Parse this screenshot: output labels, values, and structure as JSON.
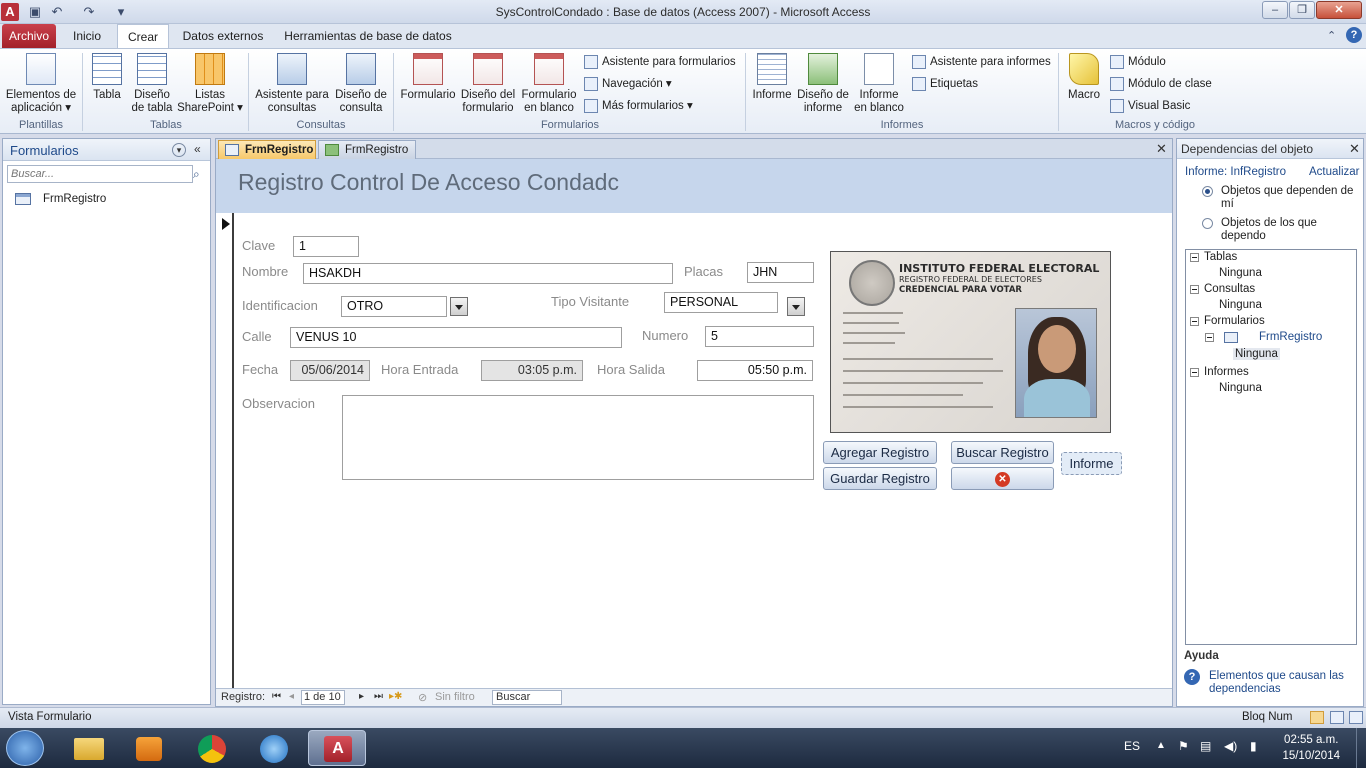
{
  "window": {
    "title": "SysControlCondado : Base de datos (Access 2007)  -  Microsoft Access",
    "min": "–",
    "max": "❐",
    "close": "✕"
  },
  "quick_access": [
    "save-icon",
    "undo-icon",
    "redo-icon",
    "customize-icon"
  ],
  "ribbon_tabs": [
    "Archivo",
    "Inicio",
    "Crear",
    "Datos externos",
    "Herramientas de base de datos"
  ],
  "ribbon": {
    "plantillas": {
      "label": "Plantillas",
      "btn1": "Elementos de",
      "btn2": "aplicación ▾"
    },
    "tablas": {
      "label": "Tablas",
      "tabla": "Tabla",
      "diseno1": "Diseño",
      "diseno2": "de tabla",
      "listas1": "Listas",
      "listas2": "SharePoint ▾"
    },
    "consultas": {
      "label": "Consultas",
      "asis1": "Asistente para",
      "asis2": "consultas",
      "dis1": "Diseño de",
      "dis2": "consulta"
    },
    "formularios": {
      "label": "Formularios",
      "form": "Formulario",
      "dis1": "Diseño del",
      "dis2": "formulario",
      "blank1": "Formulario",
      "blank2": "en blanco",
      "asis": "Asistente para formularios",
      "nav": "Navegación ▾",
      "mas": "Más formularios ▾"
    },
    "informes": {
      "label": "Informes",
      "inf": "Informe",
      "dis1": "Diseño de",
      "dis2": "informe",
      "blank1": "Informe",
      "blank2": "en blanco",
      "asis": "Asistente para informes",
      "etiq": "Etiquetas"
    },
    "macros": {
      "label": "Macros y código",
      "macro": "Macro",
      "modulo": "Módulo",
      "clase": "Módulo de clase",
      "vb": "Visual Basic"
    }
  },
  "nav_pane": {
    "title": "Formularios",
    "search_placeholder": "Buscar...",
    "items": [
      "FrmRegistro"
    ]
  },
  "doc_tabs": [
    "FrmRegistro",
    "FrmRegistro"
  ],
  "form": {
    "title": "Registro Control De Acceso Condadc",
    "fields": {
      "clave_label": "Clave",
      "clave": "1",
      "nombre_label": "Nombre",
      "nombre": "HSAKDH",
      "placas_label": "Placas",
      "placas": "JHN",
      "ident_label": "Identificacion",
      "ident": "OTRO",
      "tipo_label": "Tipo Visitante",
      "tipo": "PERSONAL",
      "calle_label": "Calle",
      "calle": "VENUS 10",
      "numero_label": "Numero",
      "numero": "5",
      "fecha_label": "Fecha",
      "fecha": "05/06/2014",
      "entrada_label": "Hora Entrada",
      "entrada": "03:05 p.m.",
      "salida_label": "Hora Salida",
      "salida": "05:50 p.m.",
      "obs_label": "Observacion",
      "obs": ""
    },
    "buttons": {
      "agregar": "Agregar Registro",
      "buscar": "Buscar Registro",
      "guardar": "Guardar Registro",
      "informe": "Informe"
    },
    "id_card": {
      "line1": "INSTITUTO FEDERAL ELECTORAL",
      "line2": "REGISTRO FEDERAL DE ELECTORES",
      "line3": "CREDENCIAL PARA VOTAR"
    }
  },
  "record_nav": {
    "label": "Registro:",
    "position": "1 de 10",
    "filter": "Sin filtro",
    "search": "Buscar"
  },
  "dependencies": {
    "title": "Dependencias del objeto",
    "report": "Informe: InfRegistro",
    "refresh": "Actualizar",
    "opt1": "Objetos que dependen de mí",
    "opt2": "Objetos de los que dependo",
    "tree": {
      "tablas": "Tablas",
      "tablas_none": "Ninguna",
      "consultas": "Consultas",
      "consultas_none": "Ninguna",
      "formularios": "Formularios",
      "frm": "FrmRegistro",
      "frm_none": "Ninguna",
      "informes": "Informes",
      "informes_none": "Ninguna"
    },
    "help_title": "Ayuda",
    "help_link": "Elementos que causan las dependencias"
  },
  "status": {
    "left": "Vista Formulario",
    "right": "Bloq Num"
  },
  "taskbar": {
    "lang": "ES",
    "time": "02:55 a.m.",
    "date": "15/10/2014"
  },
  "colors": {
    "file_tab": "#b8303a",
    "form_header": "#c6d6ec",
    "active_doc_tab": "#f7c86a",
    "link": "#1f4a8a"
  }
}
